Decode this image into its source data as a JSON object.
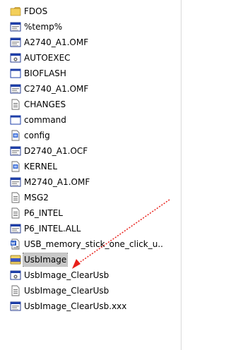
{
  "files": [
    {
      "name": "FDOS",
      "icon": "folder-icon"
    },
    {
      "name": "%temp%",
      "icon": "window-app-icon"
    },
    {
      "name": "A2740_A1.OMF",
      "icon": "window-app-icon"
    },
    {
      "name": "AUTOEXEC",
      "icon": "settings-file-icon"
    },
    {
      "name": "BIOFLASH",
      "icon": "dos-program-icon"
    },
    {
      "name": "C2740_A1.OMF",
      "icon": "window-app-icon"
    },
    {
      "name": "CHANGES",
      "icon": "text-document-icon"
    },
    {
      "name": "command",
      "icon": "dos-program-icon"
    },
    {
      "name": "config",
      "icon": "system-file-icon"
    },
    {
      "name": "D2740_A1.OCF",
      "icon": "window-app-icon"
    },
    {
      "name": "KERNEL",
      "icon": "system-file-icon"
    },
    {
      "name": "M2740_A1.OMF",
      "icon": "window-app-icon"
    },
    {
      "name": "MSG2",
      "icon": "text-document-icon"
    },
    {
      "name": "P6_INTEL",
      "icon": "text-document-icon"
    },
    {
      "name": "P6_INTEL.ALL",
      "icon": "window-app-icon"
    },
    {
      "name": "USB_memory_stick_one_click_u..",
      "icon": "word-document-icon"
    },
    {
      "name": "UsbImage",
      "icon": "disk-image-icon",
      "selected": true
    },
    {
      "name": "UsbImage_ClearUsb",
      "icon": "settings-file-icon"
    },
    {
      "name": "UsbImage_ClearUsb",
      "icon": "text-document-icon"
    },
    {
      "name": "UsbImage_ClearUsb.xxx",
      "icon": "window-app-icon"
    }
  ],
  "colors": {
    "selection_bg": "#c8c8c8",
    "arrow": "#e8201a",
    "folder": "#f3cf5a",
    "window_titlebar": "#1e3fa8"
  }
}
